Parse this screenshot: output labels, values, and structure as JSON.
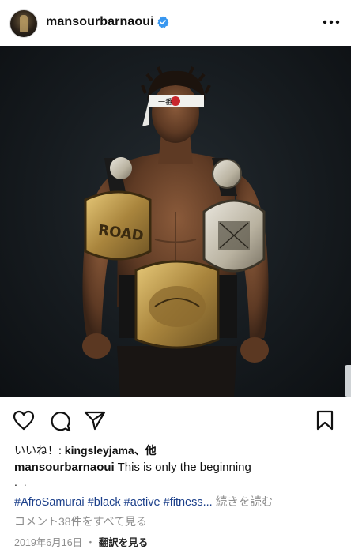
{
  "header": {
    "username": "mansourbarnaoui",
    "verified": true,
    "avatar_icon": "profile-avatar",
    "more_icon": "more-horizontal-icon"
  },
  "post_image": {
    "description_icon": "photo",
    "headband_text": "一番"
  },
  "actions": {
    "like_icon": "heart-outline-icon",
    "comment_icon": "comment-bubble-icon",
    "share_icon": "send-paper-plane-icon",
    "save_icon": "bookmark-icon"
  },
  "likes": {
    "prefix": "いいね！: ",
    "user": "kingsleyjama",
    "suffix": "、他"
  },
  "caption": {
    "user": "mansourbarnaoui",
    "text": "This is only the beginning",
    "dots": ". ."
  },
  "hashtags": {
    "tags": [
      "#AfroSamurai",
      "#black",
      "#active",
      "#fitness..."
    ],
    "more_label": "続きを読む"
  },
  "comments": {
    "view_all": "コメント38件をすべて見る"
  },
  "footer": {
    "date": "2019年6月16日",
    "separator": "・",
    "translate": "翻訳を見る"
  },
  "colors": {
    "hashtag": "#1b3f8a",
    "verified": "#3897f0",
    "muted": "#8e8e8e"
  }
}
